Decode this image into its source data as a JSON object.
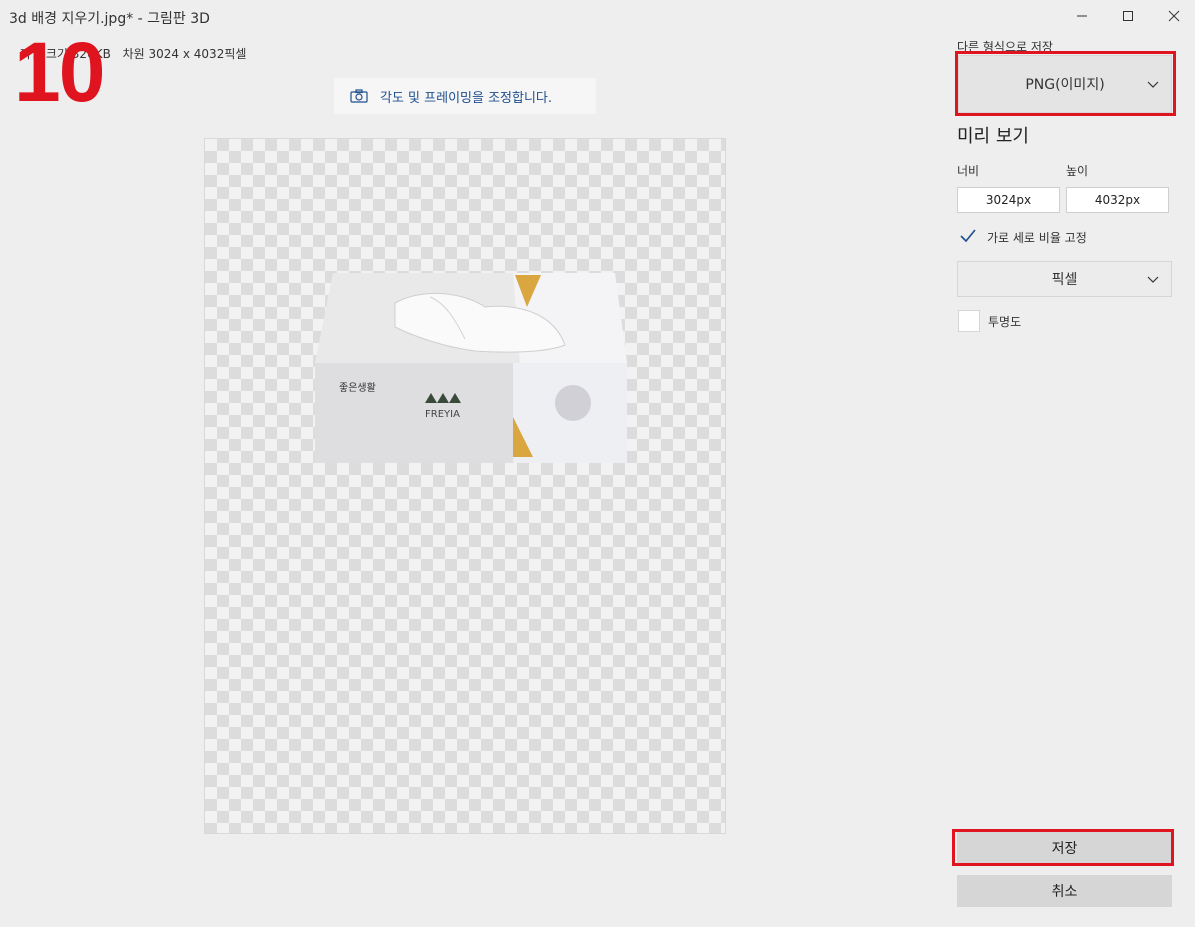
{
  "window": {
    "title": "3d 배경 지우기.jpg* - 그림판 3D"
  },
  "file_info": {
    "size": "파일 크기 326KB",
    "dimensions": "차원 3024 x 4032픽셀"
  },
  "step_number": "10",
  "framing_button": {
    "label": "각도 및 프레이밍을 조정합니다.",
    "icon": "camera-icon"
  },
  "panel": {
    "save_as_label": "다른 형식으로 저장",
    "format_value": "PNG(이미지)",
    "preview_heading": "미리 보기",
    "width_label": "너비",
    "height_label": "높이",
    "width_value": "3024px",
    "height_value": "4032px",
    "lock_ratio_label": "가로 세로 비율 고정",
    "lock_ratio_checked": true,
    "unit_value": "픽셀",
    "transparency_label": "투명도",
    "transparency_checked": false,
    "save_label": "저장",
    "cancel_label": "취소"
  },
  "colors": {
    "highlight": "#e0141e",
    "accent": "#1f4e8c"
  }
}
